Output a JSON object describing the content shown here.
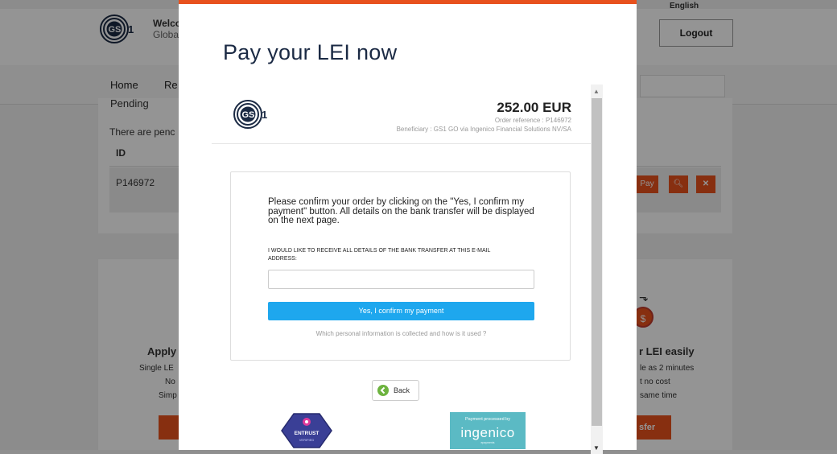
{
  "background": {
    "header": {
      "welcome": "Welco",
      "global": "Globa",
      "language": "English",
      "logout_label": "Logout"
    },
    "nav": {
      "home": "Home",
      "register": "Re"
    },
    "pending": {
      "title": "Pending",
      "text": "There are penc",
      "id_header": "ID",
      "row_id": "P146972",
      "pay_label": "Pay"
    },
    "features": {
      "apply_title": "Apply",
      "apply_lines": [
        "Single LE",
        "No",
        "Simp"
      ],
      "easy_title": "r LEI easily",
      "easy_lines": [
        "le as 2 minutes",
        "t no cost",
        "same time"
      ],
      "transfer_label": "sfer",
      "coin_symbol": "$"
    }
  },
  "modal": {
    "title": "Pay your LEI now",
    "payment": {
      "logo_text": "GS1",
      "amount": "252.00 EUR",
      "order_reference": "Order reference : P146972",
      "beneficiary": "Beneficiary : GS1 GO via Ingenico Financial Solutions NV/SA",
      "confirm_text": "Please confirm your order by clicking on the \"Yes, I confirm my payment\" button. All details on the bank transfer will be displayed on the next page.",
      "email_label": "I would like to receive all details of the bank transfer at this e-mail address:",
      "email_value": "",
      "confirm_button": "Yes, I confirm my payment",
      "info_link": "Which personal information is collected and how is it used ?",
      "back_label": "Back",
      "entrust_text": "ENTRUST",
      "entrust_sub": "VERIFIED",
      "ingenico_small": "Payment processed by",
      "ingenico_brand": "ingenico",
      "ingenico_tiny": "epayments"
    }
  },
  "colors": {
    "accent": "#e8511d",
    "confirm_blue": "#1ea7ee",
    "ingenico_teal": "#5bbac4",
    "gs1_navy": "#1b2a44",
    "back_green": "#6db33f"
  }
}
